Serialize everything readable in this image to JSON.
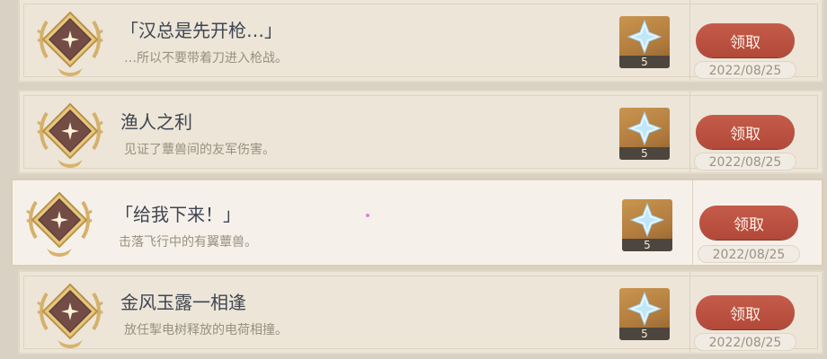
{
  "achievements": [
    {
      "title": "「汉总是先开枪…」",
      "description": "…所以不要带着刀进入枪战。",
      "reward_icon": "primogem-icon",
      "reward_qty": "5",
      "claim_label": "领取",
      "date": "2022/08/25"
    },
    {
      "title": "渔人之利",
      "description": "见证了蕈兽间的友军伤害。",
      "reward_icon": "primogem-icon",
      "reward_qty": "5",
      "claim_label": "领取",
      "date": "2022/08/25"
    },
    {
      "title": "「给我下来！」",
      "description": "击落飞行中的有翼蕈兽。",
      "reward_icon": "primogem-icon",
      "reward_qty": "5",
      "claim_label": "领取",
      "date": "2022/08/25",
      "selected": true
    },
    {
      "title": "金风玉露一相逢",
      "description": "放任掣电树释放的电荷相撞。",
      "reward_icon": "primogem-icon",
      "reward_qty": "5",
      "claim_label": "领取",
      "date": "2022/08/25"
    }
  ],
  "colors": {
    "claim_button": "#b94d3d",
    "row_bg": "#ece5d8",
    "selected_row_bg": "#f5f1ea",
    "title_text": "#3f4551",
    "description_text": "#98917f"
  }
}
